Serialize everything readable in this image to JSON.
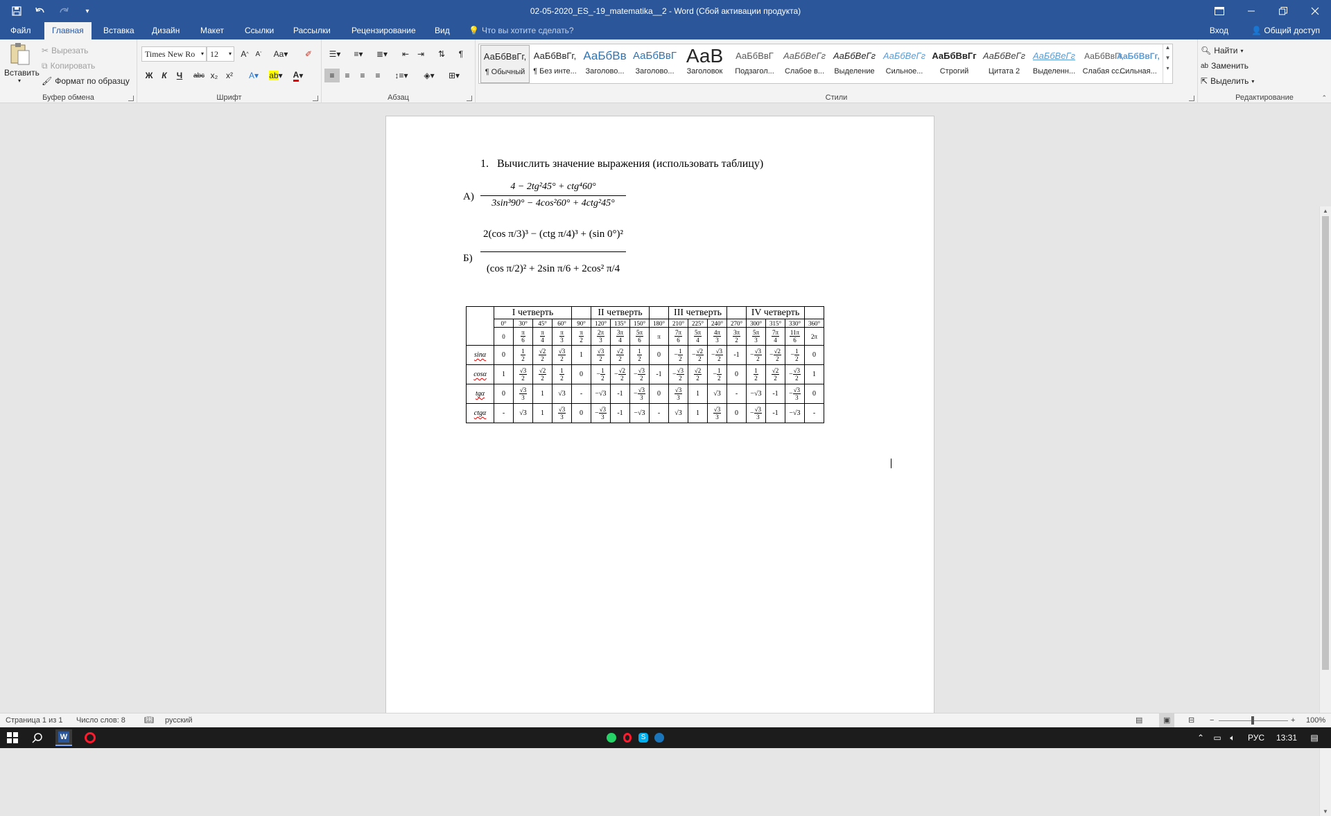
{
  "titlebar": {
    "document_title": "02-05-2020_ES_-19_matematika__2 - Word (Сбой активации продукта)",
    "icons": [
      "save-icon",
      "undo-icon",
      "redo-icon",
      "customize-qat-icon"
    ],
    "window_buttons": [
      "ribbon-display-icon",
      "minimize-icon",
      "restore-icon",
      "close-icon"
    ]
  },
  "tabs": [
    "Файл",
    "Главная",
    "Вставка",
    "Дизайн",
    "Макет",
    "Ссылки",
    "Рассылки",
    "Рецензирование",
    "Вид"
  ],
  "active_tab": "Главная",
  "tell_me": "Что вы хотите сделать?",
  "sign_in": "Вход",
  "share": "Общий доступ",
  "clipboard": {
    "paste": "Вставить",
    "cut": "Вырезать",
    "copy": "Копировать",
    "format_painter": "Формат по образцу",
    "group": "Буфер обмена"
  },
  "font": {
    "name": "Times New Ro",
    "size": "12",
    "group": "Шрифт",
    "bold": "Ж",
    "italic": "К",
    "underline": "Ч",
    "strike": "abc",
    "sub": "x₂",
    "sup": "x²",
    "case": "Aa",
    "grow": "A",
    "shrink": "A"
  },
  "paragraph": {
    "group": "Абзац"
  },
  "styles": {
    "group": "Стили",
    "items": [
      {
        "preview": "АаБбВвГг,",
        "name": "¶ Обычный"
      },
      {
        "preview": "АаБбВвГг,",
        "name": "¶ Без инте..."
      },
      {
        "preview": "АаБбВв",
        "name": "Заголово..."
      },
      {
        "preview": "АаБбВвГ",
        "name": "Заголово..."
      },
      {
        "preview": "АаВ",
        "name": "Заголовок"
      },
      {
        "preview": "АаБбВвГ",
        "name": "Подзагол..."
      },
      {
        "preview": "АаБбВеГг",
        "name": "Слабое в..."
      },
      {
        "preview": "АаБбВеГг",
        "name": "Выделение"
      },
      {
        "preview": "АаБбВеГг",
        "name": "Сильное..."
      },
      {
        "preview": "АаБбВвГг",
        "name": "Строгий"
      },
      {
        "preview": "АаБбВеГг",
        "name": "Цитата 2"
      },
      {
        "preview": "АаБбВеГг",
        "name": "Выделенн..."
      },
      {
        "preview": "АаБбВвГг,",
        "name": "Слабая сс..."
      },
      {
        "preview": "АаБбВвГг,",
        "name": "Сильная..."
      }
    ]
  },
  "editing": {
    "group": "Редактирование",
    "find": "Найти",
    "replace": "Заменить",
    "select": "Выделить"
  },
  "document": {
    "task_number": "1.",
    "task_text": "Вычислить значение выражения (использовать таблицу)",
    "label_a": "А)",
    "label_b": "Б)",
    "a_numerator": "4 − 2tg²45° + ctg⁴60°",
    "a_denominator": "3sin³90° − 4cos²60° + 4ctg²45°",
    "b_numerator": "2(cos π/3)³ − (ctg π/4)³ + (sin 0°)²",
    "b_denominator": "(cos π/2)² + 2sin π/6 + 2cos² π/4"
  },
  "trig_table": {
    "quarters": [
      "I четверть",
      "II четверть",
      "III четверть",
      "IV четверть"
    ],
    "degrees": [
      "0°",
      "30°",
      "45°",
      "60°",
      "90°",
      "120°",
      "135°",
      "150°",
      "180°",
      "210°",
      "225°",
      "240°",
      "270°",
      "300°",
      "315°",
      "330°",
      "360°"
    ],
    "radians": [
      [
        "0",
        ""
      ],
      [
        "π",
        "6"
      ],
      [
        "π",
        "4"
      ],
      [
        "π",
        "3"
      ],
      [
        "π",
        "2"
      ],
      [
        "2π",
        "3"
      ],
      [
        "3π",
        "4"
      ],
      [
        "5π",
        "6"
      ],
      [
        "π",
        ""
      ],
      [
        "7π",
        "6"
      ],
      [
        "5π",
        "4"
      ],
      [
        "4π",
        "3"
      ],
      [
        "3π",
        "2"
      ],
      [
        "5π",
        "3"
      ],
      [
        "7π",
        "4"
      ],
      [
        "11π",
        "6"
      ],
      [
        "2π",
        ""
      ]
    ],
    "rows": [
      {
        "fn": "sinα",
        "cells": [
          "0",
          "1/2",
          "√2/2",
          "√3/2",
          "1",
          "√3/2",
          "√2/2",
          "1/2",
          "0",
          "−1/2",
          "−√2/2",
          "−√3/2",
          "-1",
          "−√3/2",
          "−√2/2",
          "−1/2",
          "0"
        ]
      },
      {
        "fn": "cosα",
        "cells": [
          "1",
          "√3/2",
          "√2/2",
          "1/2",
          "0",
          "−1/2",
          "−√2/2",
          "−√3/2",
          "-1",
          "−√3/2",
          "√2/2",
          "−1/2",
          "0",
          "1/2",
          "√2/2",
          "−√3/2",
          "1"
        ]
      },
      {
        "fn": "tgα",
        "cells": [
          "0",
          "√3/3",
          "1",
          "√3",
          "-",
          "−√3",
          "-1",
          "−√3/3",
          "0",
          "√3/3",
          "1",
          "√3",
          "-",
          "−√3",
          "-1",
          "−√3/3",
          "0"
        ]
      },
      {
        "fn": "ctgα",
        "cells": [
          "-",
          "√3",
          "1",
          "√3/3",
          "0",
          "−√3/3",
          "-1",
          "−√3",
          "-",
          "√3",
          "1",
          "√3/3",
          "0",
          "−√3/3",
          "-1",
          "−√3",
          "-"
        ]
      }
    ]
  },
  "status": {
    "page": "Страница 1 из 1",
    "words": "Число слов: 8",
    "language": "русский",
    "zoom": "100%"
  },
  "taskbar": {
    "lang": "РУС",
    "time": "13:31"
  }
}
